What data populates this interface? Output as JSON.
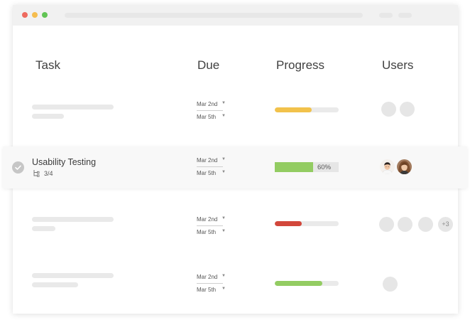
{
  "headers": {
    "task": "Task",
    "due": "Due",
    "progress": "Progress",
    "users": "Users"
  },
  "rows": [
    {
      "start": "Mar 2nd",
      "end": "Mar 5th",
      "progress": 0.58,
      "color": "#f2c24b"
    },
    {
      "title": "Usability Testing",
      "subtasks": "3/4",
      "start": "Mar 2nd",
      "end": "Mar 5th",
      "progress": 0.6,
      "progress_label": "60%",
      "color": "#93cc62"
    },
    {
      "start": "Mar 2nd",
      "end": "Mar 5th",
      "progress": 0.42,
      "color": "#d2473b",
      "more_users": "+3"
    },
    {
      "start": "Mar 2nd",
      "end": "Mar 5th",
      "progress": 0.74,
      "color": "#93cc62"
    }
  ],
  "icons": {
    "check": "check-circle-icon",
    "subtask": "subtask-tree-icon",
    "caret": "caret-down-icon"
  }
}
